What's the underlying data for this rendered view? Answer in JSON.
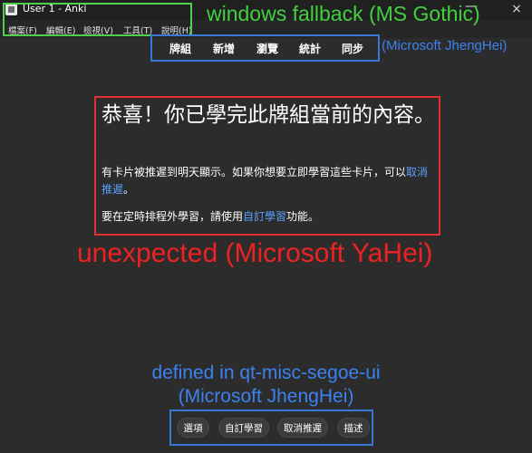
{
  "window": {
    "title": "User 1 - Anki",
    "minimize_glyph": "—",
    "close_glyph": "×"
  },
  "menu": {
    "items": [
      {
        "label": "檔案(F)"
      },
      {
        "label": "編輯(E)"
      },
      {
        "label": "檢視(V)"
      },
      {
        "label": "工具(T)"
      },
      {
        "label": "說明(H)"
      }
    ]
  },
  "toolbar": {
    "items": [
      {
        "label": "牌組"
      },
      {
        "label": "新增"
      },
      {
        "label": "瀏覽"
      },
      {
        "label": "統計"
      },
      {
        "label": "同步"
      }
    ]
  },
  "content": {
    "title": "恭喜！你已學完此牌組當前的內容。",
    "para1_text": "有卡片被推遲到明天顯示。如果你想要立即學習這些卡片，可以",
    "para1_link": "取消推遲",
    "para1_end": "。",
    "para2_text": "要在定時排程外學習，請使用",
    "para2_link": "自訂學習",
    "para2_end": "功能。"
  },
  "bottom_bar": {
    "buttons": [
      {
        "label": "選項"
      },
      {
        "label": "自訂學習"
      },
      {
        "label": "取消推遲"
      },
      {
        "label": "描述"
      }
    ]
  },
  "annotations": {
    "green": "windows fallback (MS Gothic)",
    "blue_top": "(Microsoft JhengHei)",
    "red": "unexpected (Microsoft YaHei)",
    "blue_bottom_line1": "defined in qt-misc-segoe-ui",
    "blue_bottom_line2": "(Microsoft JhengHei)"
  },
  "colors": {
    "green": "#4bd24b",
    "blue": "#3a78d8",
    "red": "#e53030",
    "link": "#5aa0ff",
    "background": "#2c2c2c"
  }
}
